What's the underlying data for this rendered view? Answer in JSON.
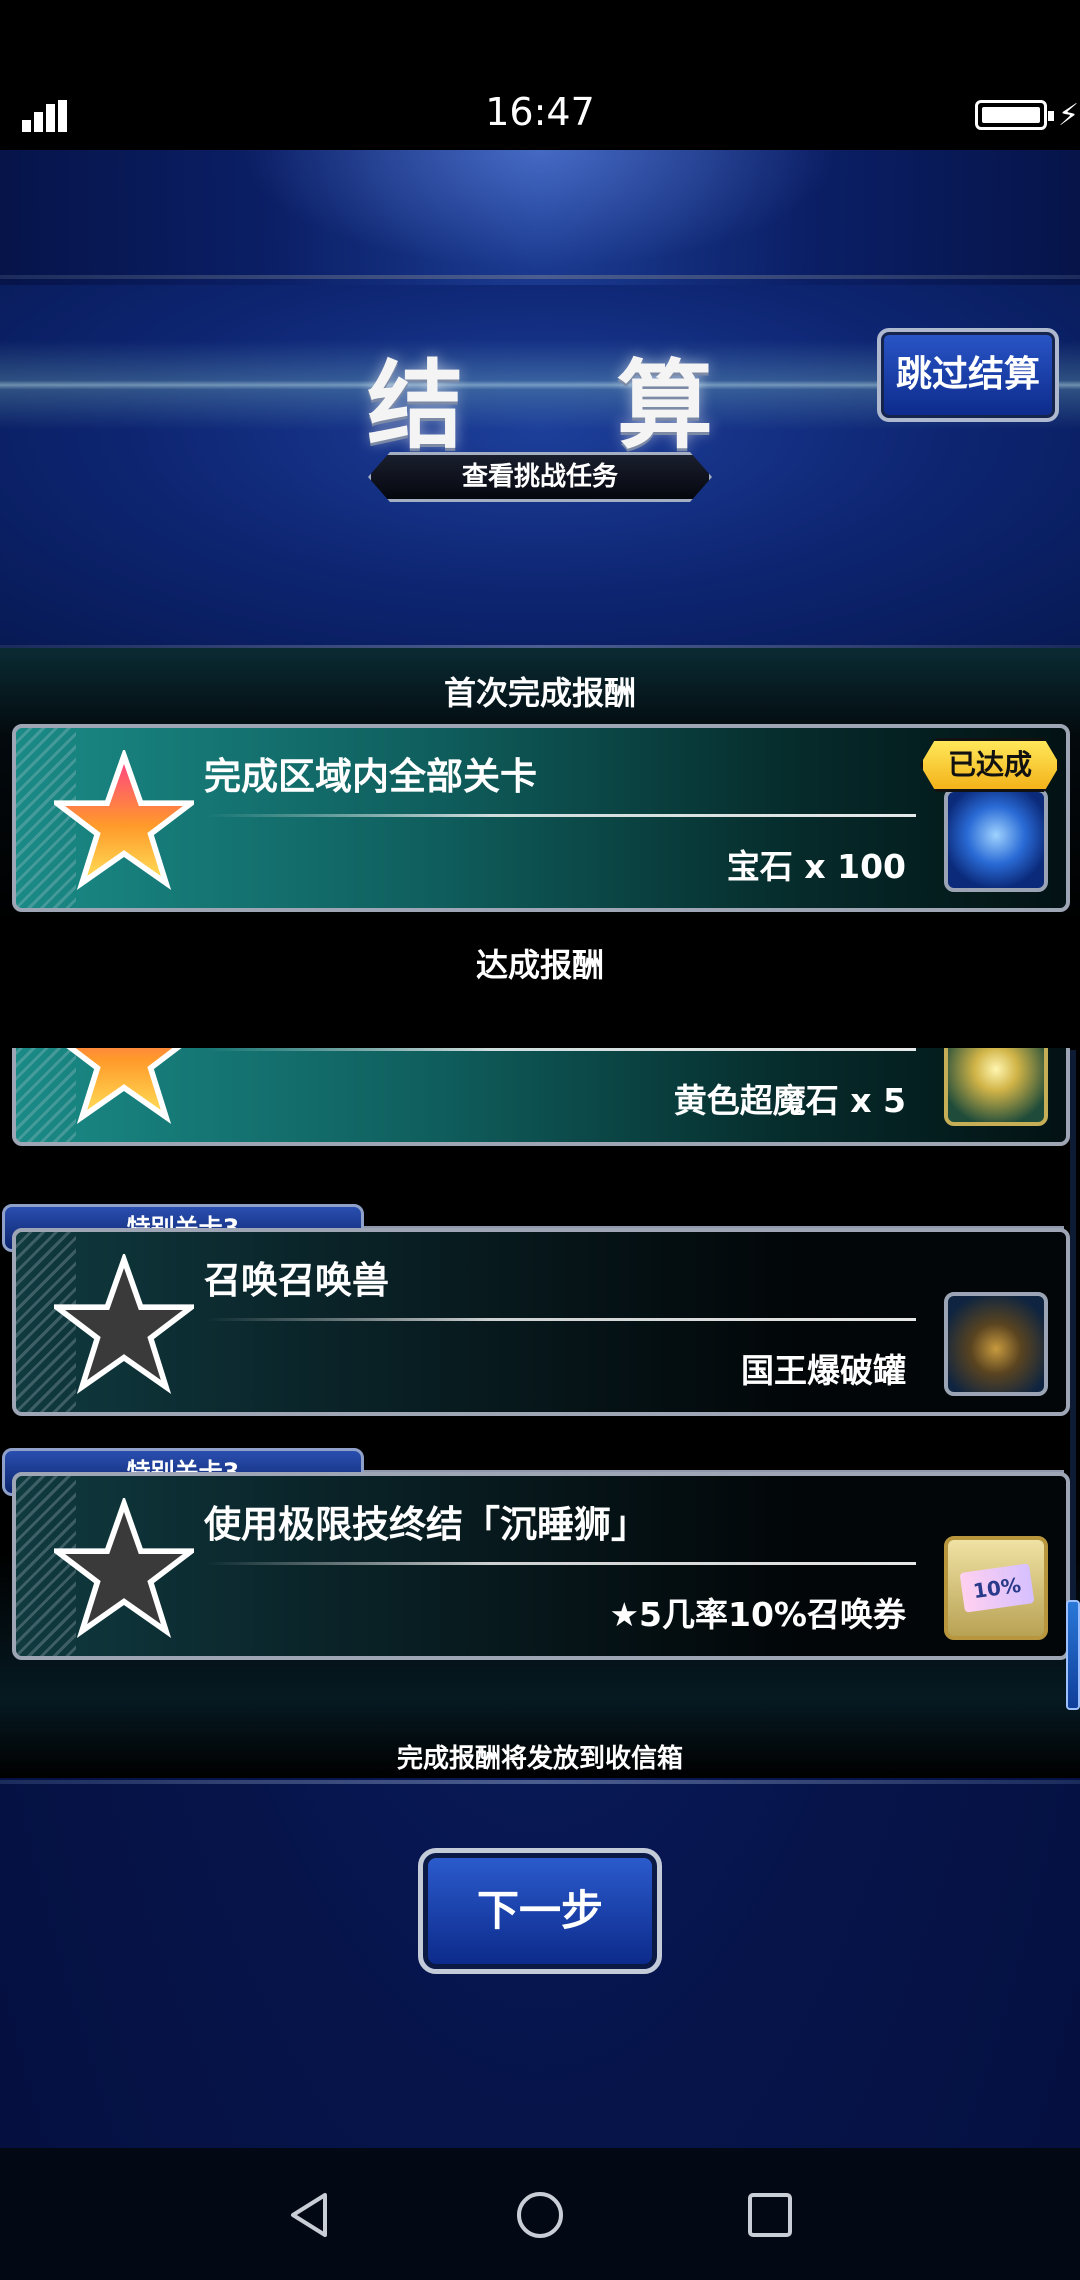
{
  "status_bar": {
    "time": "16:47"
  },
  "header": {
    "title": "结 算",
    "skip_button": "跳过结算",
    "challenge_button": "查看挑战任务"
  },
  "sections": {
    "first_clear": "首次完成报酬",
    "achievement": "达成报酬"
  },
  "first_clear_reward": {
    "name": "完成区域内全部关卡",
    "reward": "宝石 x 100",
    "badge": "已达成",
    "icon": "gem-icon",
    "star": "gold"
  },
  "achievements": [
    {
      "name": "",
      "reward": "黄色超魔石 x 5",
      "icon": "yellow-stone-icon",
      "star": "gold"
    },
    {
      "stage": "特别关卡3",
      "name": "召唤召唤兽",
      "reward": "国王爆破罐",
      "icon": "bomb-pot-icon",
      "star": "dark"
    },
    {
      "stage": "特别关卡3",
      "name": "使用极限技终结「沉睡狮」",
      "reward": "★5几率10%召唤券",
      "icon": "ticket-icon",
      "ticket_text": "10%",
      "star": "dark"
    }
  ],
  "notice": "完成报酬将发放到收信箱",
  "next_button": "下一步",
  "colors": {
    "background": "#0b1f66",
    "button_blue": "#1f48b8",
    "badge_yellow": "#f7c928",
    "card_teal": "#0f5e5d"
  }
}
